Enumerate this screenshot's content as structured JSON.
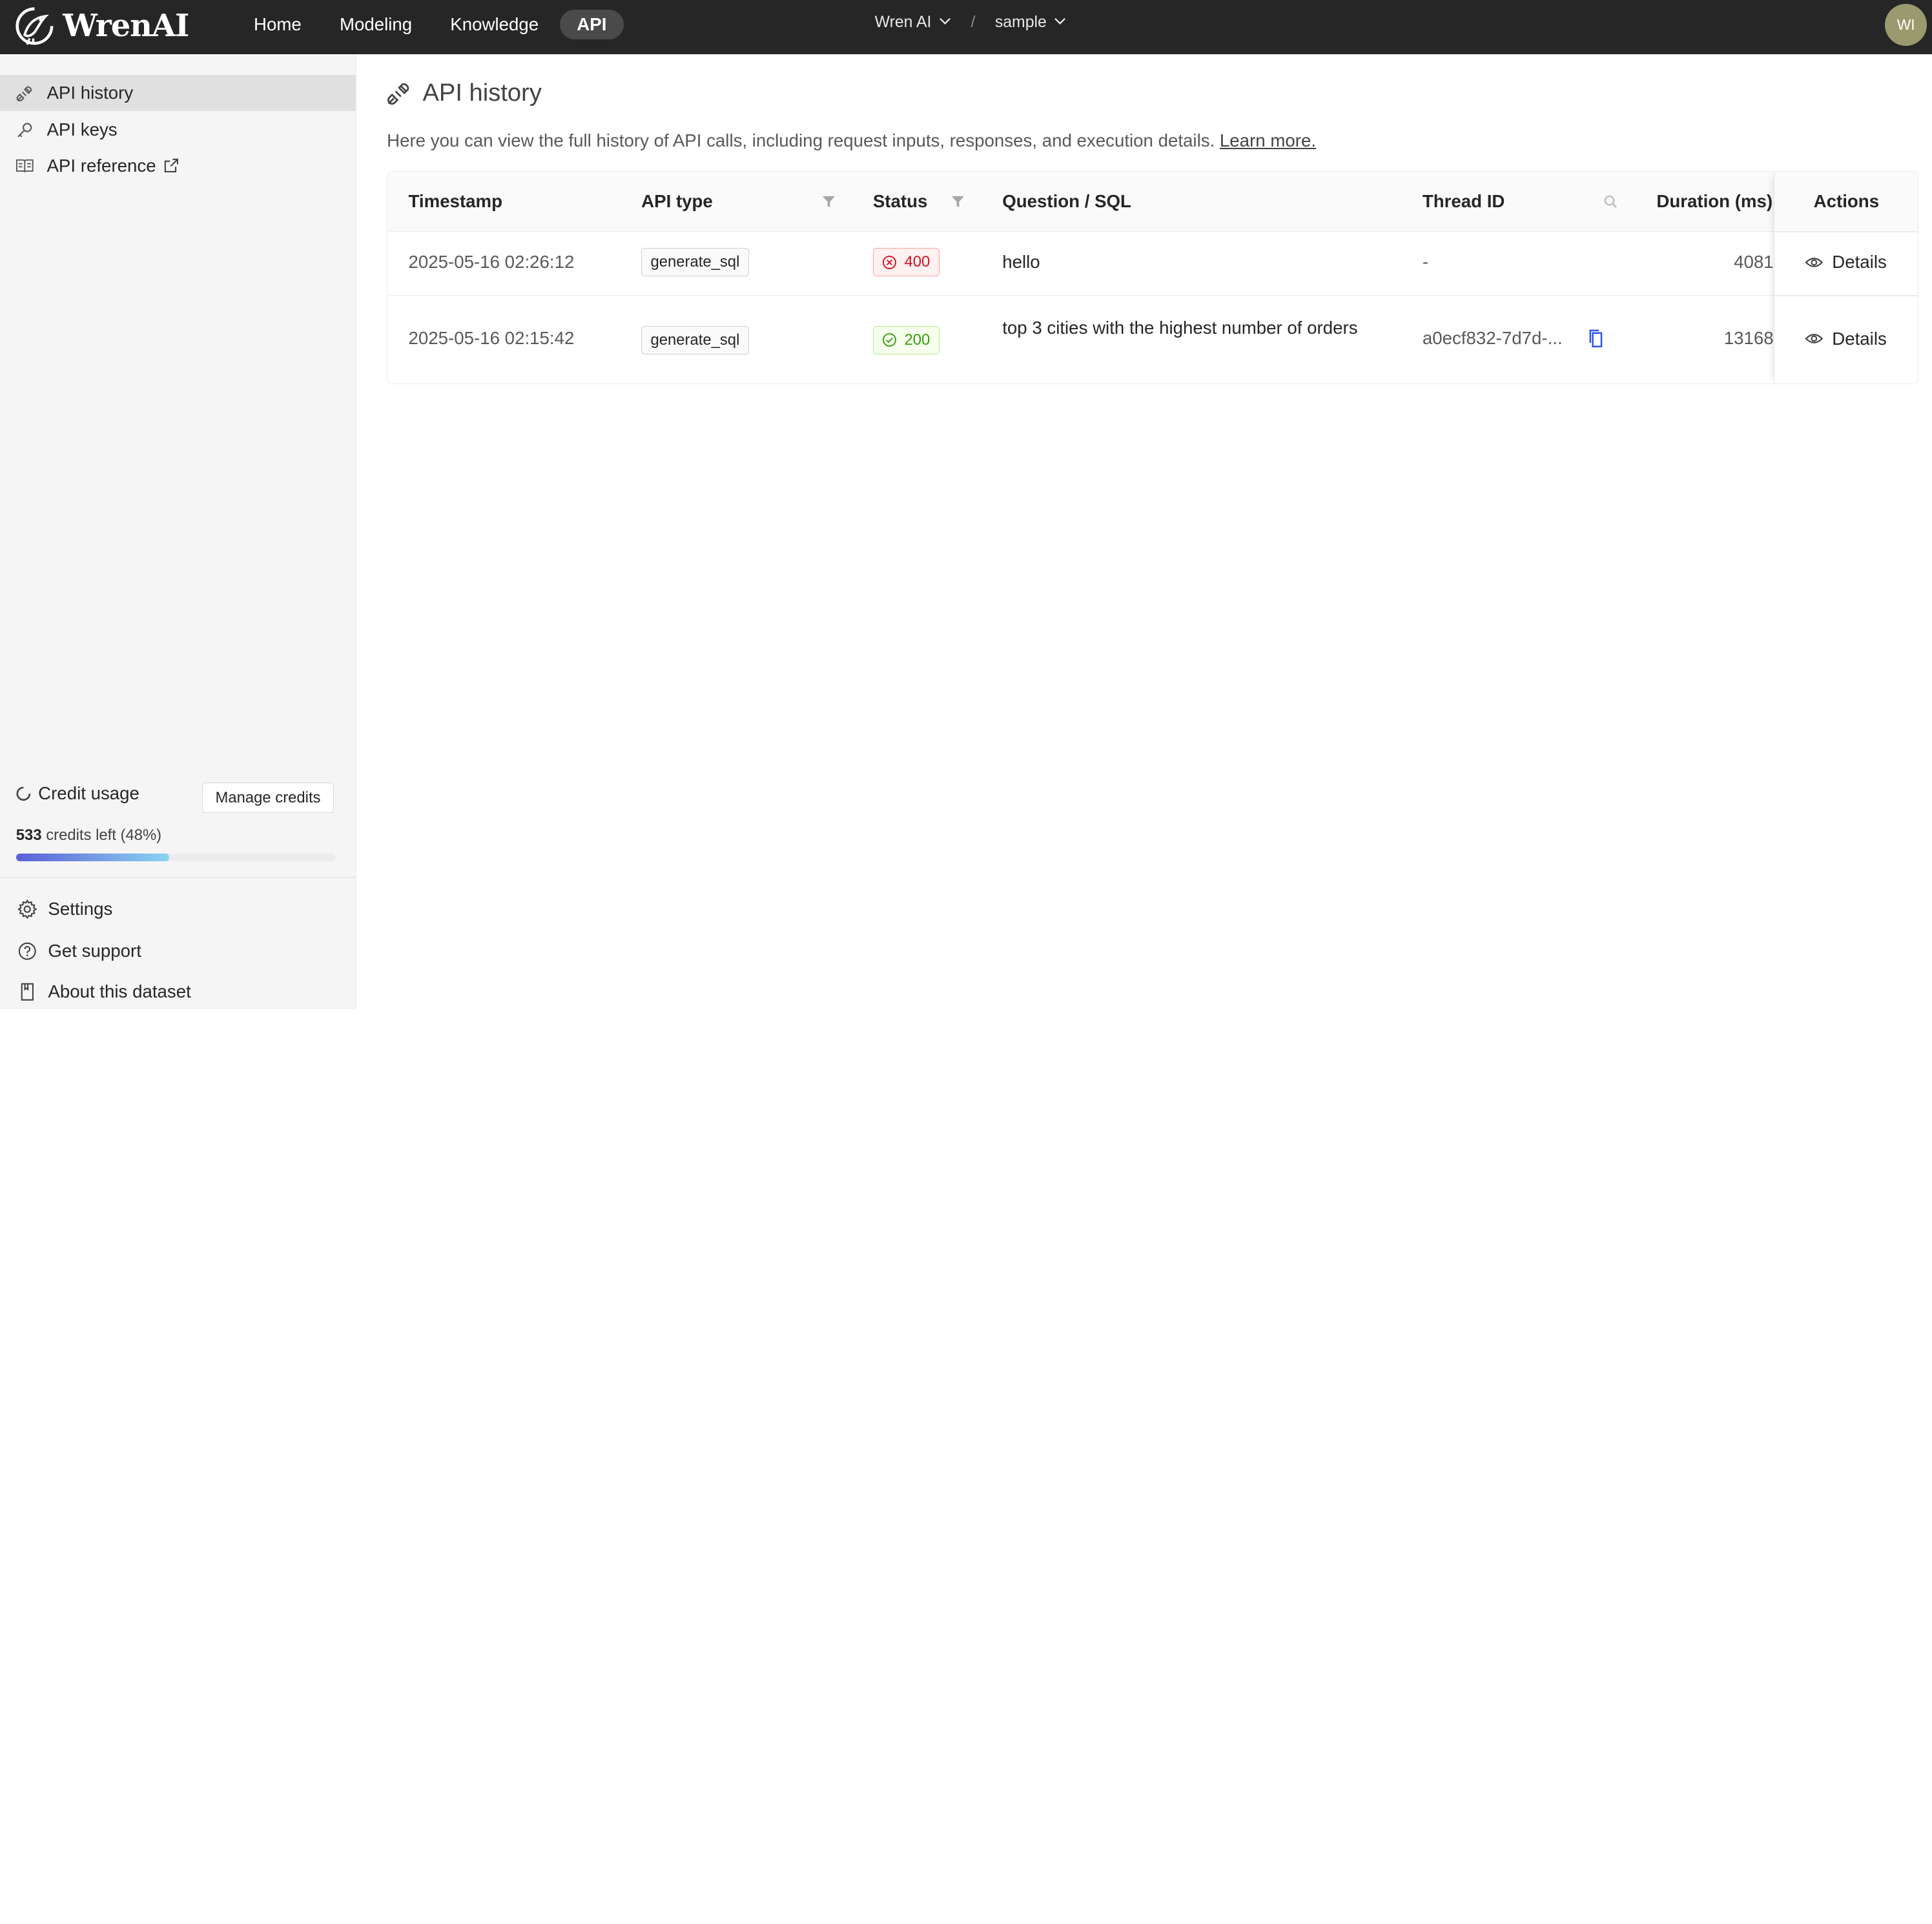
{
  "app": {
    "name": "WrenAI"
  },
  "nav": {
    "home": "Home",
    "modeling": "Modeling",
    "knowledge": "Knowledge",
    "api": "API"
  },
  "context": {
    "workspace": "Wren AI",
    "separator": "/",
    "project": "sample"
  },
  "user": {
    "initials": "WI"
  },
  "sidebar": {
    "items": [
      {
        "label": "API history",
        "icon": "api-icon",
        "active": true
      },
      {
        "label": "API keys",
        "icon": "key-icon"
      },
      {
        "label": "API reference",
        "icon": "book-icon"
      }
    ],
    "credit": {
      "label": "Credit usage",
      "manage_label": "Manage credits",
      "credits_count": "533",
      "credits_suffix": "credits left (48%)",
      "progress": 0.48
    },
    "bottom": [
      {
        "label": "Settings",
        "icon": "gear-icon"
      },
      {
        "label": "Get support",
        "icon": "question-icon"
      },
      {
        "label": "About this dataset",
        "icon": "bookmark-icon"
      }
    ]
  },
  "main": {
    "title": "API history",
    "description": "Here you can view the full history of API calls, including request inputs, responses, and execution details.",
    "learn_more": "Learn more.",
    "table": {
      "columns": [
        "Timestamp",
        "API type",
        "Status",
        "Question / SQL",
        "Thread ID",
        "Duration (ms)",
        "Actions"
      ],
      "rows": [
        {
          "timestamp": "2025-05-16 02:26:12",
          "api_type": "generate_sql",
          "status": "400",
          "question": "hello",
          "thread_id": "-",
          "duration": "4081",
          "action": "Details"
        },
        {
          "timestamp": "2025-05-16 02:15:42",
          "api_type": "generate_sql",
          "status": "200",
          "question": "top 3 cities with the highest number of orders",
          "thread_id": "a0ecf832-7d7d-...",
          "duration": "13168",
          "action": "Details"
        }
      ]
    }
  },
  "colors": {
    "topbar": "#262626",
    "error": "#cf1322",
    "success": "#389e0d",
    "copy_icon": "#2f54eb"
  }
}
